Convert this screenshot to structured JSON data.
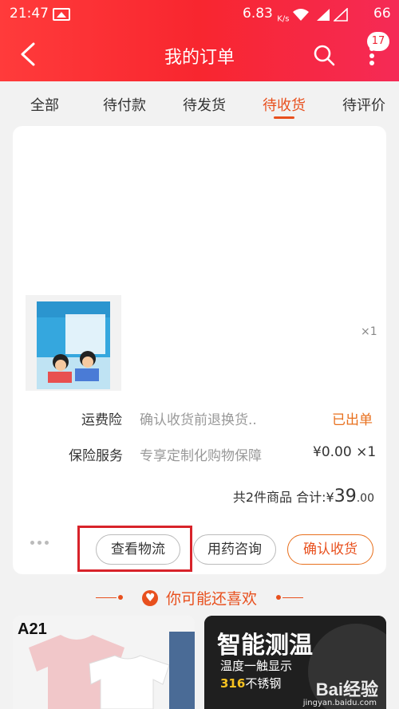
{
  "status_bar": {
    "time": "21:47",
    "speed": "6.83",
    "speed_unit": "K/s",
    "battery": "66"
  },
  "header": {
    "title": "我的订单",
    "badge_count": "17"
  },
  "tabs": [
    {
      "label": "全部",
      "active": false
    },
    {
      "label": "待付款",
      "active": false
    },
    {
      "label": "待发货",
      "active": false
    },
    {
      "label": "待收货",
      "active": true
    },
    {
      "label": "待评价",
      "active": false
    }
  ],
  "order": {
    "item_qty": "×1",
    "shipping_insurance": {
      "label": "运费险",
      "desc": "确认收货前退换货..",
      "status": "已出单"
    },
    "insurance_service": {
      "label": "保险服务",
      "desc": "专享定制化购物保障",
      "price": "¥0.00 ×1"
    },
    "summary": {
      "count_text": "共2件商品",
      "total_label": "合计:",
      "currency": "¥",
      "total_int": "39",
      "total_dec": ".00"
    },
    "buttons": {
      "logistics": "查看物流",
      "consult": "用药咨询",
      "confirm": "确认收货"
    }
  },
  "recommend": {
    "title": "你可能还喜欢",
    "tile1_brand": "A21",
    "tile2_title": "智能测温",
    "tile2_sub1": "温度一触显示",
    "tile2_sub2_highlight": "316",
    "tile2_sub2_rest": "不锈钢"
  },
  "watermark": {
    "main": "Bai经验",
    "sub": "jingyan.baidu.com"
  },
  "colors": {
    "header_red": "#f8262f",
    "accent_orange": "#e8501e",
    "highlight_box": "#d8232a"
  }
}
